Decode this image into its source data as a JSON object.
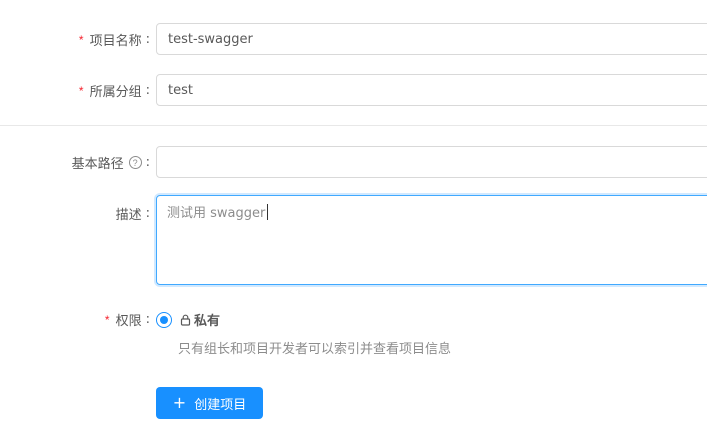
{
  "form": {
    "project_name": {
      "label": "项目名称",
      "required_mark": "*",
      "value": "test-swagger"
    },
    "group": {
      "label": "所属分组",
      "required_mark": "*",
      "value": "test"
    },
    "base_path": {
      "label": "基本路径",
      "help_icon": "?",
      "value": ""
    },
    "description": {
      "label": "描述",
      "value": "测试用 swagger"
    },
    "permission": {
      "label": "权限",
      "required_mark": "*",
      "option_label": "私有",
      "option_icon": "lock-icon",
      "selected": true,
      "hint": "只有组长和项目开发者可以索引并查看项目信息"
    },
    "colon": ":"
  },
  "submit": {
    "label": "创建项目",
    "icon": "+"
  },
  "colors": {
    "accent": "#1890ff",
    "required": "#f5222d",
    "border": "#d9d9d9"
  }
}
